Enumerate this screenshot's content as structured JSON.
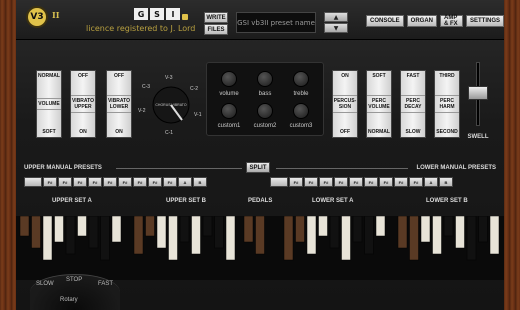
{
  "header": {
    "logo_text": "V3",
    "version_mark": "II",
    "gsi_letters": [
      "G",
      "S",
      "I"
    ],
    "licence": "licence registered to J. Lord",
    "write_label": "WRITE",
    "files_label": "FILES",
    "preset_name": "GSI vb3II preset name",
    "up_icon": "triangle-up-icon",
    "down_icon": "triangle-down-icon",
    "nav": [
      "CONSOLE",
      "ORGAN",
      "AMP & FX",
      "SETTINGS"
    ]
  },
  "controls": {
    "volume_tab": {
      "top": "NORMAL",
      "mid": "VOLUME",
      "bottom": "SOFT"
    },
    "vibrato_upper_tab": {
      "top": "OFF",
      "mid": "VIBRATO UPPER",
      "bottom": "ON"
    },
    "vibrato_lower_tab": {
      "top": "OFF",
      "mid": "VIBRATO LOWER",
      "bottom": "ON"
    },
    "vibrato_selector": {
      "labels": [
        "C-3",
        "V-3",
        "C-2",
        "V-2",
        "C-1",
        "V-1"
      ],
      "center": "CHORUS VIBRATO"
    },
    "knobs": [
      "volume",
      "bass",
      "treble",
      "custom1",
      "custom2",
      "custom3"
    ],
    "percussion_tab": {
      "top": "ON",
      "mid": "PERCUS- SION",
      "bottom": "OFF"
    },
    "perc_volume_tab": {
      "top": "SOFT",
      "mid": "PERC VOLUME",
      "bottom": "NORMAL"
    },
    "perc_decay_tab": {
      "top": "FAST",
      "mid": "PERC DECAY",
      "bottom": "SLOW"
    },
    "perc_harm_tab": {
      "top": "THIRD",
      "mid": "PERC HARM",
      "bottom": "SECOND"
    },
    "swell_label": "SWELL"
  },
  "presets": {
    "upper_title": "UPPER MANUAL PRESETS",
    "lower_title": "LOWER MANUAL PRESETS",
    "split_label": "SPLIT",
    "upper_buttons": [
      "",
      "F#",
      "F#",
      "F#",
      "F#",
      "F#",
      "F#",
      "F#",
      "F#",
      "F#",
      "A",
      "B"
    ],
    "lower_buttons": [
      "",
      "F#",
      "F#",
      "F#",
      "F#",
      "F#",
      "F#",
      "F#",
      "F#",
      "F#",
      "A",
      "B"
    ]
  },
  "sections": {
    "upper_a": "UPPER SET A",
    "upper_b": "UPPER SET B",
    "pedals": "PEDALS",
    "lower_a": "LOWER SET A",
    "lower_b": "LOWER SET B"
  },
  "drawbar_colors": {
    "brown": "#5a3a24",
    "white": "#e8e4d8",
    "black": "#111111"
  },
  "rotary": {
    "slow": "SLOW",
    "stop": "STOP",
    "fast": "FAST",
    "word": "Rotary"
  }
}
